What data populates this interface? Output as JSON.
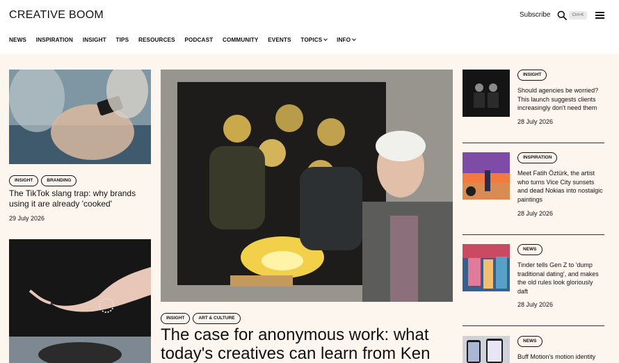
{
  "header": {
    "logo": "CREATIVE BOOM",
    "subscribe": "Subscribe",
    "shortcut": "Ctrl+K"
  },
  "nav": {
    "items": [
      "NEWS",
      "INSPIRATION",
      "INSIGHT",
      "TIPS",
      "RESOURCES",
      "PODCAST",
      "COMMUNITY",
      "EVENTS",
      "TOPICS",
      "INFO"
    ]
  },
  "left": {
    "card1": {
      "tags": [
        "INSIGHT",
        "BRANDING"
      ],
      "title": "The TikTok slang trap: why brands using it are already 'cooked'",
      "date": "29 July 2026"
    }
  },
  "feature": {
    "tags": [
      "INSIGHT",
      "ART & CULTURE"
    ],
    "title": "The case for anonymous work: what today's creatives can learn from Ken"
  },
  "sidebar": [
    {
      "tag": "INSIGHT",
      "title": "Should agencies be worried? This launch suggests clients increasingly don't need them",
      "date": "28 July 2026"
    },
    {
      "tag": "INSPIRATION",
      "title": "Meet Fatih Öztürk, the artist who turns Vice City sunsets and dead Nokias into nostalgic paintings",
      "date": "28 July 2026"
    },
    {
      "tag": "NEWS",
      "title": "Tinder tells Gen Z to 'dump traditional dating', and makes the old rules look gloriously daft",
      "date": "28 July 2026"
    },
    {
      "tag": "NEWS",
      "title": "Buff Motion's motion identity"
    }
  ]
}
